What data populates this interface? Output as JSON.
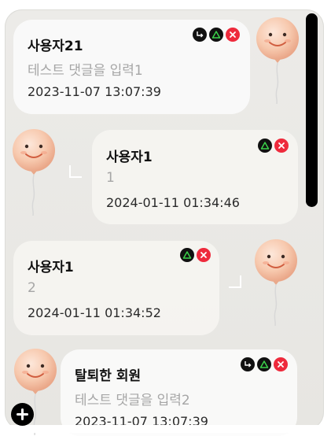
{
  "comments": [
    {
      "author": "사용자21",
      "content": "테스트 댓글을 입력1",
      "timestamp": "2023-11-07 13:07:39",
      "icons": [
        "reply-icon",
        "edit-icon",
        "delete-icon"
      ]
    },
    {
      "author": "사용자1",
      "content": "1",
      "timestamp": "2024-01-11 01:34:46",
      "icons": [
        "edit-icon",
        "delete-icon"
      ]
    },
    {
      "author": "사용자1",
      "content": "2",
      "timestamp": "2024-01-11 01:34:52",
      "icons": [
        "edit-icon",
        "delete-icon"
      ]
    },
    {
      "author": "탈퇴한 회원",
      "content": "테스트 댓글을 입력2",
      "timestamp": "2023-11-07 13:07:39",
      "icons": [
        "reply-icon",
        "edit-icon",
        "delete-icon"
      ]
    }
  ],
  "colors": {
    "delete": "#ee2a3c",
    "icon_dark": "#111111",
    "balloon": "#f6c3a6",
    "scrollbar": "#000000"
  },
  "add_button_icon": "plus-icon",
  "avatar_icon": "balloon-smiley-icon"
}
